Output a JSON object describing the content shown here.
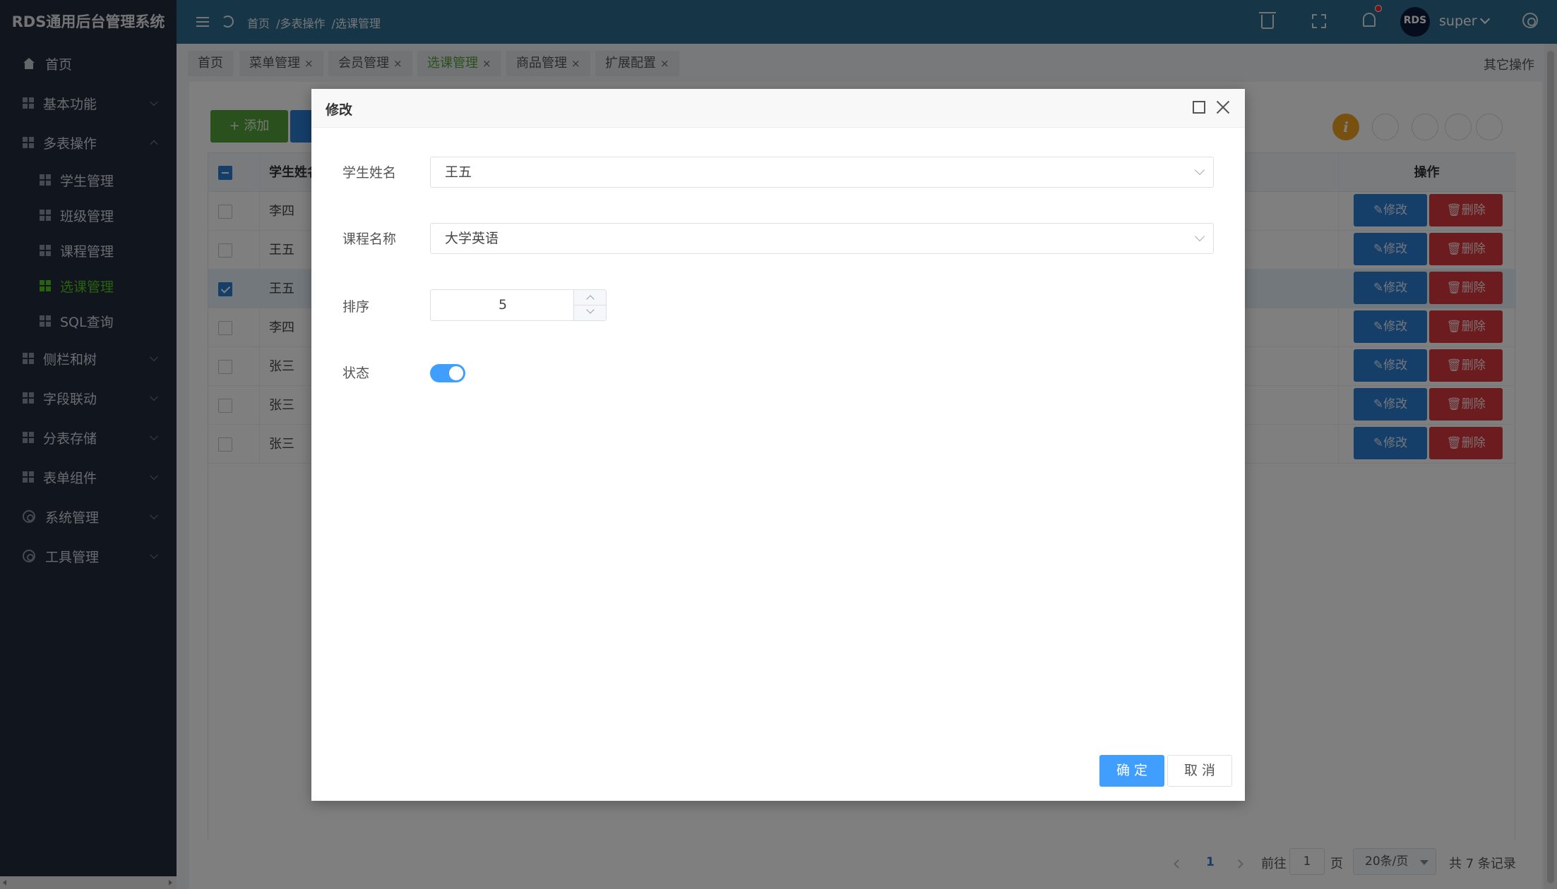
{
  "app": {
    "title": "RDS通用后台管理系统"
  },
  "sidebar": {
    "items": [
      {
        "label": "首页",
        "icon": "home-icon"
      },
      {
        "label": "基本功能",
        "icon": "grid-icon"
      },
      {
        "label": "多表操作",
        "icon": "grid-icon",
        "expanded": true
      },
      {
        "label": "侧栏和树",
        "icon": "grid-icon"
      },
      {
        "label": "字段联动",
        "icon": "grid-icon"
      },
      {
        "label": "分表存储",
        "icon": "grid-icon"
      },
      {
        "label": "表单组件",
        "icon": "grid-icon"
      },
      {
        "label": "系统管理",
        "icon": "gear-icon"
      },
      {
        "label": "工具管理",
        "icon": "gear-icon"
      }
    ],
    "sub_items": [
      {
        "label": "学生管理"
      },
      {
        "label": "班级管理"
      },
      {
        "label": "课程管理"
      },
      {
        "label": "选课管理",
        "active": true
      },
      {
        "label": "SQL查询"
      }
    ],
    "active_color": "#52c41a"
  },
  "header": {
    "breadcrumb": [
      "首页",
      "/多表操作",
      "/选课管理"
    ],
    "avatar_text": "RDS",
    "user": "super"
  },
  "tabs": {
    "items": [
      {
        "label": "首页",
        "closable": false
      },
      {
        "label": "菜单管理",
        "closable": true
      },
      {
        "label": "会员管理",
        "closable": true
      },
      {
        "label": "选课管理",
        "closable": true,
        "active": true
      },
      {
        "label": "商品管理",
        "closable": true
      },
      {
        "label": "扩展配置",
        "closable": true
      }
    ],
    "close_glyph": "×",
    "other_ops": "其它操作"
  },
  "toolbar": {
    "add_label": "+ 添加",
    "info_glyph": "i"
  },
  "table": {
    "header_name": "学生姓名",
    "header_ops": "操作",
    "rows": [
      {
        "name": "李四",
        "checked": false
      },
      {
        "name": "王五",
        "checked": false
      },
      {
        "name": "王五",
        "checked": true
      },
      {
        "name": "李四",
        "checked": false
      },
      {
        "name": "张三",
        "checked": false
      },
      {
        "name": "张三",
        "checked": false
      },
      {
        "name": "张三",
        "checked": false
      }
    ],
    "edit_label": "✎修改",
    "delete_label": "🗑删除"
  },
  "pager": {
    "current": "1",
    "goto_prefix": "前往",
    "goto_value": "1",
    "goto_suffix": "页",
    "page_size": "20条/页",
    "total": "共 7 条记录"
  },
  "modal": {
    "title": "修改",
    "fields": {
      "student_label": "学生姓名",
      "student_value": "王五",
      "course_label": "课程名称",
      "course_value": "大学英语",
      "sort_label": "排序",
      "sort_value": "5",
      "status_label": "状态",
      "status_on": true
    },
    "ok_label": "确 定",
    "cancel_label": "取 消"
  },
  "colors": {
    "topbar": "#2c6a8f",
    "sidebar": "#222d3c",
    "primary": "#409eff",
    "edit_button": "#2b7cd3",
    "delete_button": "#d9363e",
    "add_button": "#52a03a"
  }
}
